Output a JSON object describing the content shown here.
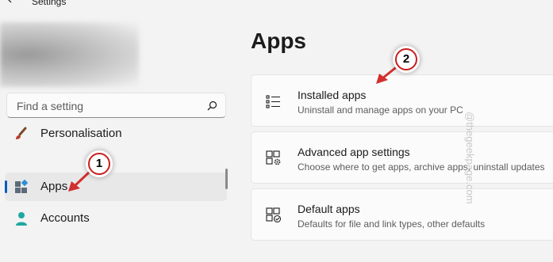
{
  "window": {
    "title": "Settings"
  },
  "search": {
    "placeholder": "Find a setting"
  },
  "sidebar": {
    "items": [
      {
        "label": "Personalisation",
        "icon": "paintbrush-icon"
      },
      {
        "label": "Apps",
        "icon": "apps-icon",
        "selected": true
      },
      {
        "label": "Accounts",
        "icon": "accounts-icon"
      }
    ]
  },
  "main": {
    "title": "Apps",
    "cards": [
      {
        "title": "Installed apps",
        "description": "Uninstall and manage apps on your PC",
        "icon": "installed-apps-icon"
      },
      {
        "title": "Advanced app settings",
        "description": "Choose where to get apps, archive apps, uninstall updates",
        "icon": "advanced-app-settings-icon"
      },
      {
        "title": "Default apps",
        "description": "Defaults for file and link types, other defaults",
        "icon": "default-apps-icon"
      }
    ]
  },
  "annotations": [
    {
      "number": "1"
    },
    {
      "number": "2"
    }
  ],
  "watermark": "@thegeekpage.com",
  "colors": {
    "accent": "#005fb8",
    "callout_border": "#c81e1e",
    "arrow": "#d32f2f"
  }
}
